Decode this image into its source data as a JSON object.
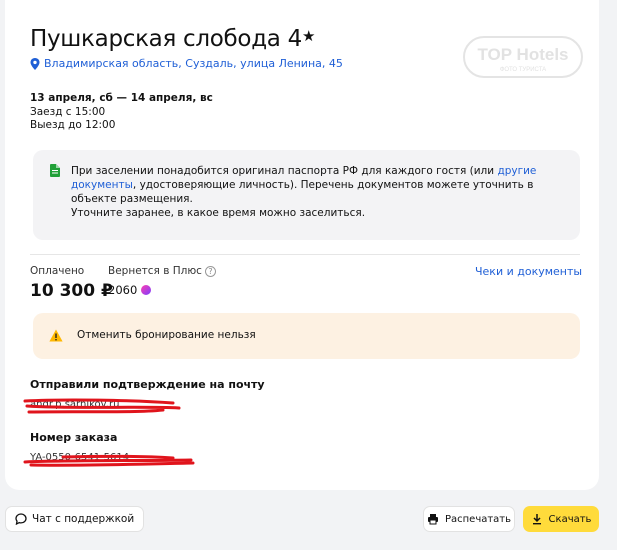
{
  "hotel": {
    "name": "Пушкарская слобода 4",
    "star_glyph": "★",
    "address": "Владимирская область, Суздаль, улица Ленина, 45"
  },
  "watermark": {
    "brand": "TOP Hotels",
    "tagline": "ФОТО ТУРИСТА"
  },
  "stay": {
    "dates": "13 апреля, сб — 14 апреля, вс",
    "checkin": "Заезд с 15:00",
    "checkout": "Выезд до 12:00"
  },
  "notice": {
    "part1": "При заселении понадобится оригинал паспорта РФ для каждого гостя (или ",
    "link": "другие документы",
    "part2": ", удостоверяющие личность). Перечень документов можете уточнить в объекте размещения.",
    "line2": "Уточните заранее, в какое время можно заселиться."
  },
  "payment": {
    "paid_label": "Оплачено",
    "paid_value": "10 300 ₽",
    "back_label": "Вернется в Плюс",
    "back_value": "2060",
    "checks_link": "Чеки и документы"
  },
  "cancel_warning": "Отменить бронирование нельзя",
  "confirmation": {
    "label": "Отправили подтверждение на почту",
    "value": "andr.p.sarnikov.ru"
  },
  "order": {
    "label": "Номер заказа",
    "value": "YA-0550-6541-5614"
  },
  "footer": {
    "chat": "Чат с поддержкой",
    "print": "Распечатать",
    "download": "Скачать"
  },
  "colors": {
    "link": "#1f5fd6",
    "warn_bg": "#fdf1e2",
    "download_bg": "#ffdb3b",
    "redaction": "#e0141c"
  }
}
